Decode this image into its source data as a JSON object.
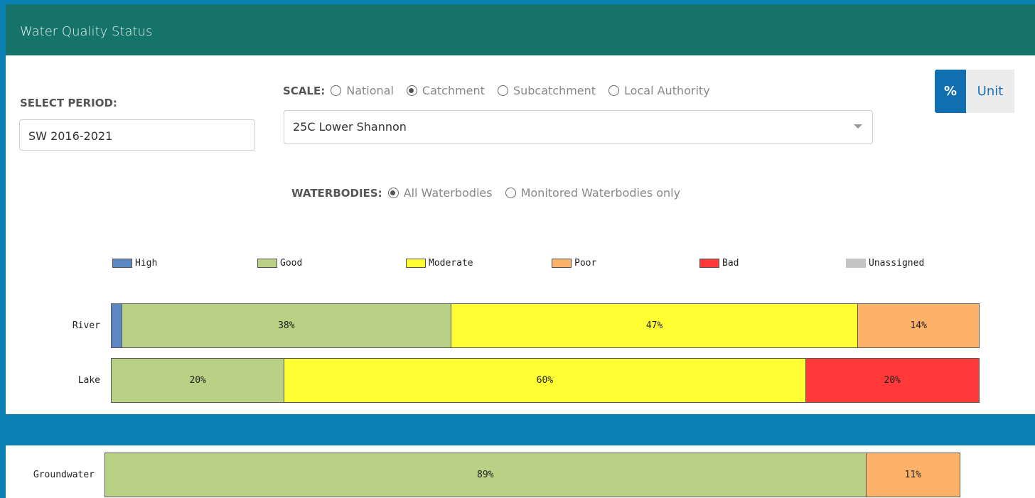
{
  "header": {
    "title": "Water Quality Status"
  },
  "period": {
    "label": "SELECT PERIOD:",
    "value": "SW 2016-2021"
  },
  "scale": {
    "label": "SCALE:",
    "options": [
      "National",
      "Catchment",
      "Subcatchment",
      "Local Authority"
    ],
    "selected": "Catchment",
    "dropdown_value": "25C Lower Shannon"
  },
  "waterbodies": {
    "label": "WATERBODIES:",
    "options": [
      "All Waterbodies",
      "Monitored Waterbodies only"
    ],
    "selected": "All Waterbodies"
  },
  "toggle": {
    "percent_label": "%",
    "unit_label": "Unit",
    "active": "%"
  },
  "chart_data": {
    "type": "bar",
    "orientation": "horizontal-stacked",
    "legend": [
      {
        "name": "High",
        "color": "#5b87c2"
      },
      {
        "name": "Good",
        "color": "#b8d185"
      },
      {
        "name": "Moderate",
        "color": "#ffff33"
      },
      {
        "name": "Poor",
        "color": "#fdb26a"
      },
      {
        "name": "Bad",
        "color": "#ff3838"
      },
      {
        "name": "Unassigned",
        "color": "#c4c4c4"
      }
    ],
    "rows": [
      {
        "label": "River",
        "segments": [
          {
            "category": "High",
            "value": 1.3,
            "text": ""
          },
          {
            "category": "Good",
            "value": 38,
            "text": "38%"
          },
          {
            "category": "Moderate",
            "value": 47,
            "text": "47%"
          },
          {
            "category": "Poor",
            "value": 14,
            "text": "14%"
          }
        ]
      },
      {
        "label": "Lake",
        "segments": [
          {
            "category": "Good",
            "value": 20,
            "text": "20%"
          },
          {
            "category": "Moderate",
            "value": 60,
            "text": "60%"
          },
          {
            "category": "Bad",
            "value": 20,
            "text": "20%"
          }
        ]
      },
      {
        "label": "Groundwater",
        "segments": [
          {
            "category": "Good",
            "value": 89,
            "text": "89%"
          },
          {
            "category": "Poor",
            "value": 11,
            "text": "11%"
          }
        ]
      }
    ]
  }
}
